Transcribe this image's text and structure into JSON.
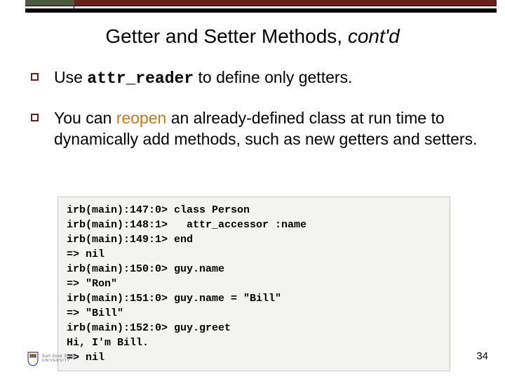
{
  "title": {
    "main": "Getter and Setter Methods, ",
    "italic": "cont'd"
  },
  "bullets": [
    {
      "pre": "Use ",
      "mono": "attr_reader",
      "post": " to define only getters."
    },
    {
      "pre": "You can ",
      "hl": "reopen",
      "post": " an already-defined class at run time to dynamically add methods, such as new getters and setters."
    }
  ],
  "code": "irb(main):147:0> class Person\nirb(main):148:1>   attr_accessor :name\nirb(main):149:1> end\n=> nil\nirb(main):150:0> guy.name\n=> \"Ron\"\nirb(main):151:0> guy.name = \"Bill\"\n=> \"Bill\"\nirb(main):152:0> guy.greet\nHi, I'm Bill.\n=> nil",
  "logo": {
    "line1": "San José State",
    "line2": "UNIVERSITY"
  },
  "page": "34"
}
